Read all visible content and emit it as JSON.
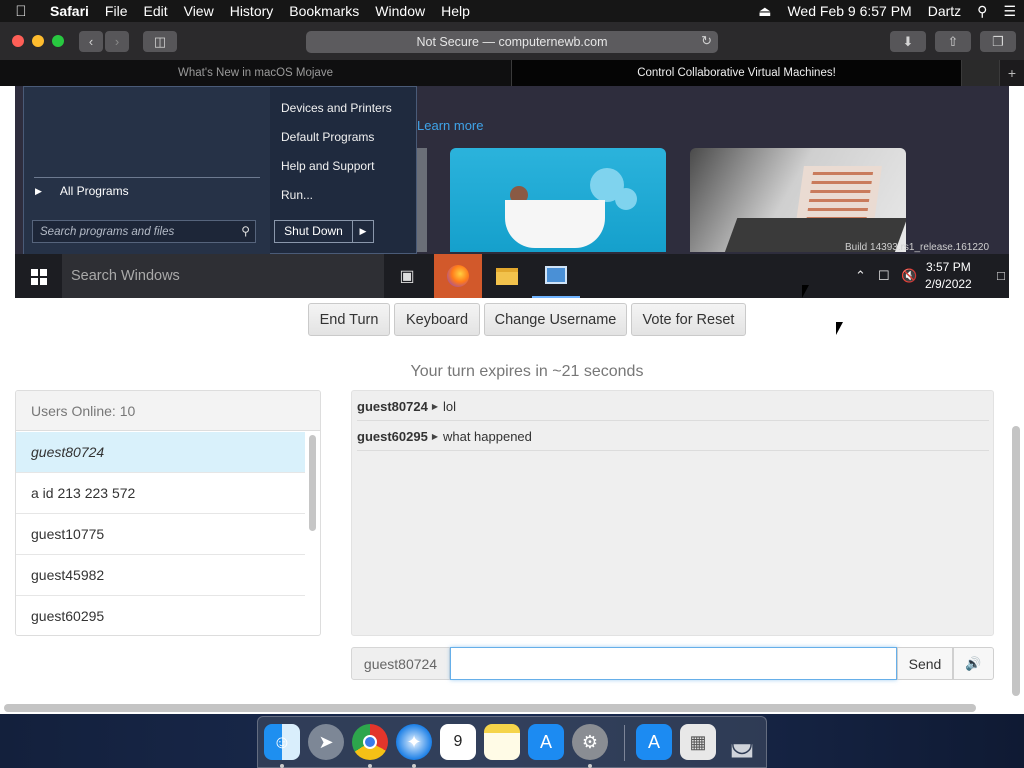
{
  "menubar": {
    "app": "Safari",
    "items": [
      "File",
      "Edit",
      "View",
      "History",
      "Bookmarks",
      "Window",
      "Help"
    ],
    "datetime": "Wed Feb 9  6:57 PM",
    "user": "Dartz"
  },
  "browser": {
    "address": "Not Secure — computernewb.com",
    "tabs": [
      {
        "title": "What's New in macOS Mojave",
        "active": false
      },
      {
        "title": "Control Collaborative Virtual Machines!",
        "active": true
      }
    ]
  },
  "vm": {
    "learn_more": "Learn more",
    "build_text": "Build 14393.rs1_release.161220",
    "start_menu": {
      "right_items": [
        "Devices and Printers",
        "Default Programs",
        "Help and Support",
        "Run..."
      ],
      "all_programs": "All Programs",
      "search_placeholder": "Search programs and files",
      "shutdown": "Shut Down"
    },
    "taskbar": {
      "search": "Search Windows",
      "time": "3:57 PM",
      "date": "2/9/2022"
    }
  },
  "controls": {
    "buttons": [
      "End Turn",
      "Keyboard",
      "Change Username",
      "Vote for Reset"
    ],
    "turn_message": "Your turn expires in ~21 seconds"
  },
  "users": {
    "header": "Users Online: 10",
    "list": [
      "guest80724",
      "a id 213 223 572",
      "guest10775",
      "guest45982",
      "guest60295"
    ]
  },
  "chat": {
    "messages": [
      {
        "user": "guest80724",
        "text": "lol"
      },
      {
        "user": "guest60295",
        "text": "what happened"
      }
    ],
    "username": "guest80724",
    "input_value": "",
    "send_label": "Send"
  },
  "colors": {
    "accent": "#66afe9",
    "selected_user": "#d9f1fb",
    "link": "#3fa3e8"
  }
}
